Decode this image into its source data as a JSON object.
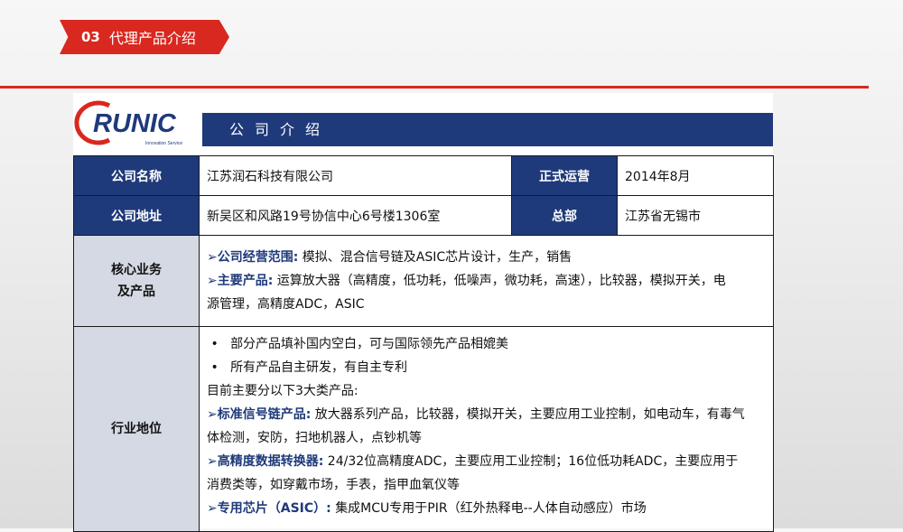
{
  "header": {
    "number": "03",
    "title": "代理产品介绍"
  },
  "logo": {
    "text": "RUNIC",
    "tagline": "Innovation Service"
  },
  "band": {
    "title": "公司介绍"
  },
  "rows": {
    "name_label": "公司名称",
    "name_value": "江苏润石科技有限公司",
    "start_label": "正式运营",
    "start_value": "2014年8月",
    "addr_label": "公司地址",
    "addr_value": "新吴区和风路19号协信中心6号楼1306室",
    "hq_label": "总部",
    "hq_value": "江苏省无锡市"
  },
  "core": {
    "label_1": "核心业务",
    "label_2": "及产品",
    "scope_label": "公司经营范围:",
    "scope_text": "模拟、混合信号链及ASIC芯片设计，生产，销售",
    "products_label": "主要产品:",
    "products_text": "运算放大器（高精度，低功耗，低噪声，微功耗，高速），比较器，模拟开关，电",
    "products_text_2": "源管理，高精度ADC，ASIC"
  },
  "industry": {
    "label": "行业地位",
    "bullet_1": "部分产品填补国内空白，可与国际领先产品相媲美",
    "bullet_2": "所有产品自主研发，有自主专利",
    "intro": "目前主要分以下3大类产品:",
    "cat1_label": "标准信号链产品:",
    "cat1_text": "放大器系列产品，比较器，模拟开关，主要应用工业控制，如电动车，有毒气",
    "cat1_text_2": "体检测，安防，扫地机器人，点钞机等",
    "cat2_label": "高精度数据转换器:",
    "cat2_text": "24/32位高精度ADC，主要应用工业控制；16位低功耗ADC，主要应用于",
    "cat2_text_2": "消费类等，如穿戴市场，手表，指甲血氧仪等",
    "cat3_label": "专用芯片（ASIC）:",
    "cat3_text": "集成MCU专用于PIR（红外热释电--人体自动感应）市场"
  },
  "colors": {
    "accent_red": "#d9281f",
    "navy": "#1f3a7a",
    "label_gray": "#d4d9e3"
  }
}
